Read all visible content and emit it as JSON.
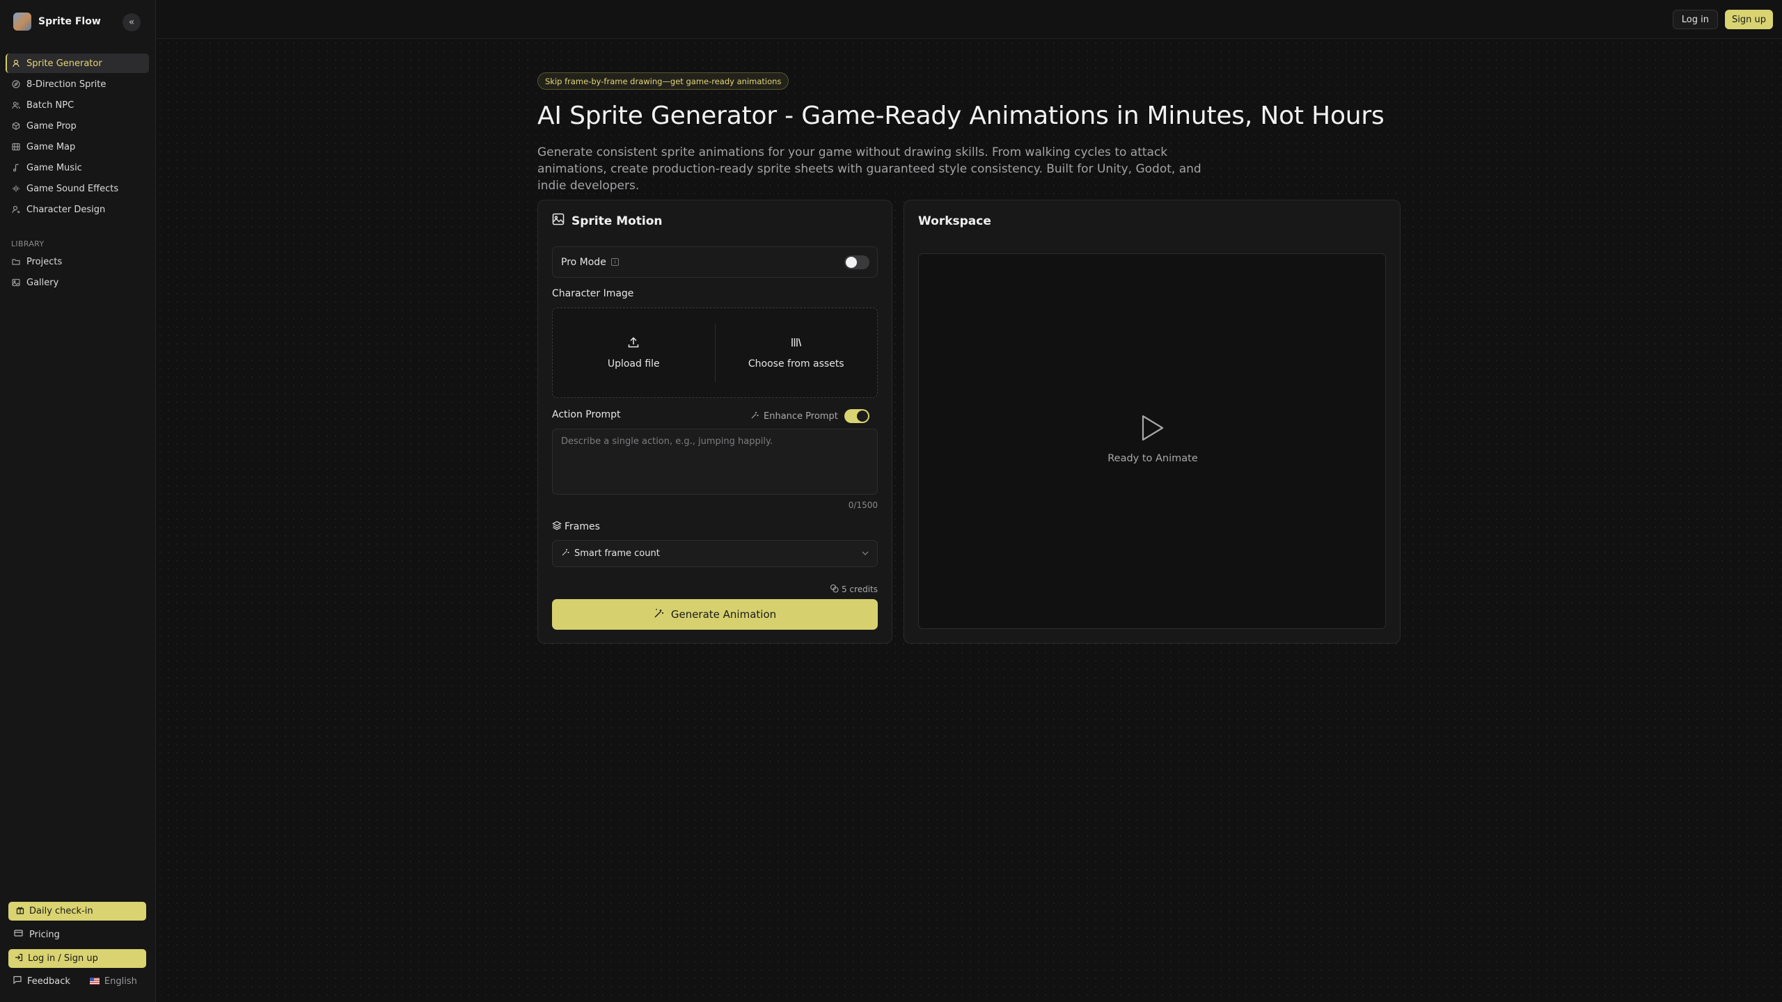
{
  "brand": {
    "name": "Sprite Flow"
  },
  "sidebar": {
    "items": [
      {
        "label": "Sprite Generator",
        "icon": "sprite-icon",
        "active": true
      },
      {
        "label": "8-Direction Sprite",
        "icon": "compass-icon"
      },
      {
        "label": "Batch NPC",
        "icon": "users-icon"
      },
      {
        "label": "Game Prop",
        "icon": "prop-icon"
      },
      {
        "label": "Game Map",
        "icon": "map-icon"
      },
      {
        "label": "Game Music",
        "icon": "music-note-icon"
      },
      {
        "label": "Game Sound Effects",
        "icon": "sound-wave-icon"
      },
      {
        "label": "Character Design",
        "icon": "character-icon"
      }
    ],
    "library_label": "LIBRARY",
    "library": [
      {
        "label": "Projects",
        "icon": "folder-icon"
      },
      {
        "label": "Gallery",
        "icon": "image-icon"
      }
    ],
    "daily_checkin": "Daily check-in",
    "pricing": "Pricing",
    "login_signup": "Log in / Sign up",
    "feedback": "Feedback",
    "language": "English"
  },
  "topbar": {
    "login": "Log in",
    "signup": "Sign up"
  },
  "hero": {
    "pill": "Skip frame-by-frame drawing—get game-ready animations",
    "title": "AI Sprite Generator - Game-Ready Animations in Minutes, Not Hours",
    "subtitle": "Generate consistent sprite animations for your game without drawing skills. From walking cycles to attack animations, create production-ready sprite sheets with guaranteed style consistency. Built for Unity, Godot, and indie developers."
  },
  "form": {
    "title": "Sprite Motion",
    "pro_mode": "Pro Mode",
    "pro_mode_on": false,
    "character_image": "Character Image",
    "upload_file": "Upload file",
    "choose_assets": "Choose from assets",
    "action_prompt": "Action Prompt",
    "enhance_prompt": "Enhance Prompt",
    "enhance_on": true,
    "prompt_placeholder": "Describe a single action, e.g., jumping happily.",
    "prompt_value": "",
    "counter": "0/1500",
    "frames": "Frames",
    "frames_value": "Smart frame count",
    "credits": "5 credits",
    "generate": "Generate Animation"
  },
  "workspace": {
    "title": "Workspace",
    "status": "Ready to Animate"
  },
  "colors": {
    "accent": "#d9d371",
    "background": "#111112",
    "sidebar": "#161617"
  }
}
